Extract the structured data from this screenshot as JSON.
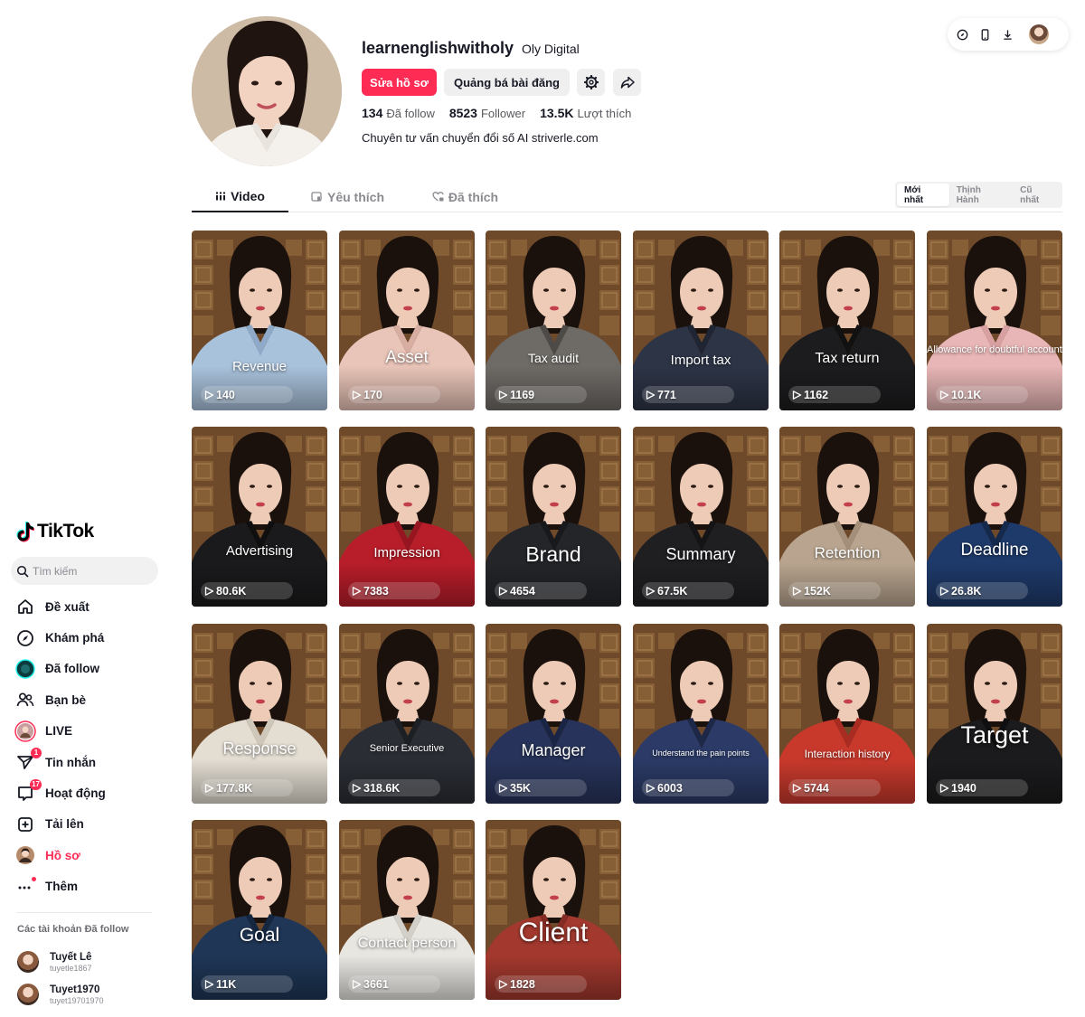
{
  "app": {
    "name": "TikTok"
  },
  "search": {
    "placeholder": "Tìm kiếm"
  },
  "nav": [
    {
      "label": "Đề xuất",
      "icon": "home-icon"
    },
    {
      "label": "Khám phá",
      "icon": "compass-icon"
    },
    {
      "label": "Đã follow",
      "icon": "following-avatar-icon"
    },
    {
      "label": "Bạn bè",
      "icon": "friends-icon"
    },
    {
      "label": "LIVE",
      "icon": "live-icon"
    },
    {
      "label": "Tin nhắn",
      "icon": "messages-icon",
      "badge": "1"
    },
    {
      "label": "Hoạt động",
      "icon": "activity-icon",
      "badge": "17"
    },
    {
      "label": "Tải lên",
      "icon": "upload-icon"
    },
    {
      "label": "Hồ sơ",
      "icon": "profile-avatar-icon",
      "active": true
    },
    {
      "label": "Thêm",
      "icon": "more-icon"
    }
  ],
  "following": {
    "title": "Các tài khoản Đã follow",
    "accounts": [
      {
        "name": "Tuyết Lê",
        "handle": "tuyetle1867"
      },
      {
        "name": "Tuyet1970",
        "handle": "tuyet19701970"
      }
    ]
  },
  "profile": {
    "username": "learnenglishwitholy",
    "nickname": "Oly Digital",
    "edit_label": "Sửa hồ sơ",
    "promote_label": "Quảng bá bài đăng",
    "following_count": "134",
    "following_label": "Đã follow",
    "followers_count": "8523",
    "followers_label": "Follower",
    "likes_count": "13.5K",
    "likes_label": "Lượt thích",
    "bio": "Chuyên tư vấn chuyển đổi số AI striverle.com"
  },
  "tabs": [
    {
      "label": "Video",
      "active": true
    },
    {
      "label": "Yêu thích"
    },
    {
      "label": "Đã thích"
    }
  ],
  "sort": [
    {
      "label": "Mới nhất",
      "active": true
    },
    {
      "label": "Thịnh Hành"
    },
    {
      "label": "Cũ nhất"
    }
  ],
  "videos": [
    {
      "title": "Revenue",
      "views": "140"
    },
    {
      "title": "Asset",
      "views": "170"
    },
    {
      "title": "Tax audit",
      "views": "1169"
    },
    {
      "title": "Import tax",
      "views": "771"
    },
    {
      "title": "Tax return",
      "views": "1162"
    },
    {
      "title": "Allowance for doubtful accounts",
      "views": "10.1K"
    },
    {
      "title": "Advertising",
      "views": "80.6K"
    },
    {
      "title": "Impression",
      "views": "7383"
    },
    {
      "title": "Brand",
      "views": "4654"
    },
    {
      "title": "Summary",
      "views": "67.5K"
    },
    {
      "title": "Retention",
      "views": "152K"
    },
    {
      "title": "Deadline",
      "views": "26.8K"
    },
    {
      "title": "Response",
      "views": "177.8K"
    },
    {
      "title": "Senior Executive",
      "views": "318.6K"
    },
    {
      "title": "Manager",
      "views": "35K"
    },
    {
      "title": "Understand the pain points",
      "views": "6003"
    },
    {
      "title": "Interaction history",
      "views": "5744"
    },
    {
      "title": "Target",
      "views": "1940"
    },
    {
      "title": "Goal",
      "views": "11K"
    },
    {
      "title": "Contact person",
      "views": "3661"
    },
    {
      "title": "Client",
      "views": "1828"
    }
  ],
  "colors": {
    "accent": "#fe2c55",
    "text": "#161823"
  }
}
